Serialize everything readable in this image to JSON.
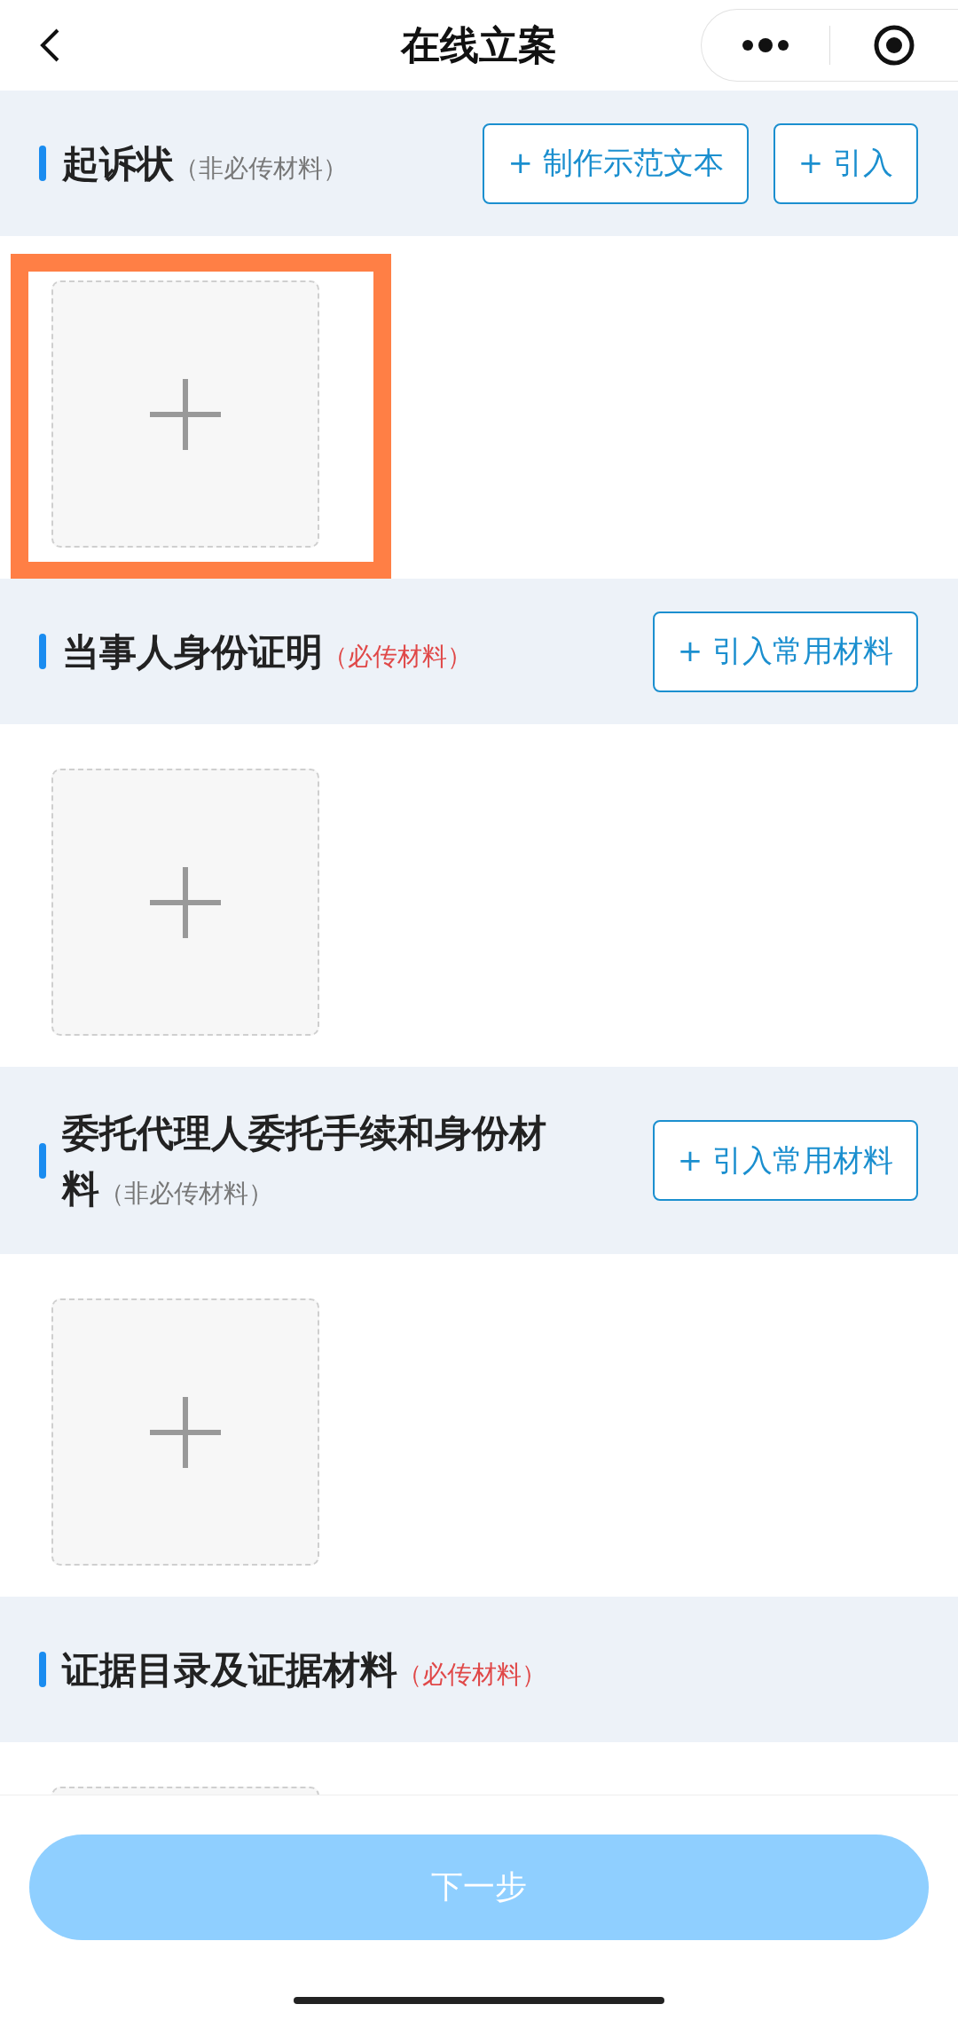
{
  "header": {
    "title": "在线立案"
  },
  "sections": [
    {
      "title": "起诉状",
      "note": "（非必传材料）",
      "required": false,
      "buttons": [
        "+ 制作示范文本",
        "+ 引入"
      ],
      "highlighted": true
    },
    {
      "title": "当事人身份证明",
      "note": "（必传材料）",
      "required": true,
      "buttons": [
        "+ 引入常用材料"
      ],
      "highlighted": false
    },
    {
      "title": "委托代理人委托手续和身份材料",
      "note": "（非必传材料）",
      "required": false,
      "buttons": [
        "+ 引入常用材料"
      ],
      "highlighted": false
    },
    {
      "title": "证据目录及证据材料",
      "note": "（必传材料）",
      "required": true,
      "highlighted": false
    }
  ],
  "footer": {
    "button": "下一步",
    "disabled": true
  }
}
